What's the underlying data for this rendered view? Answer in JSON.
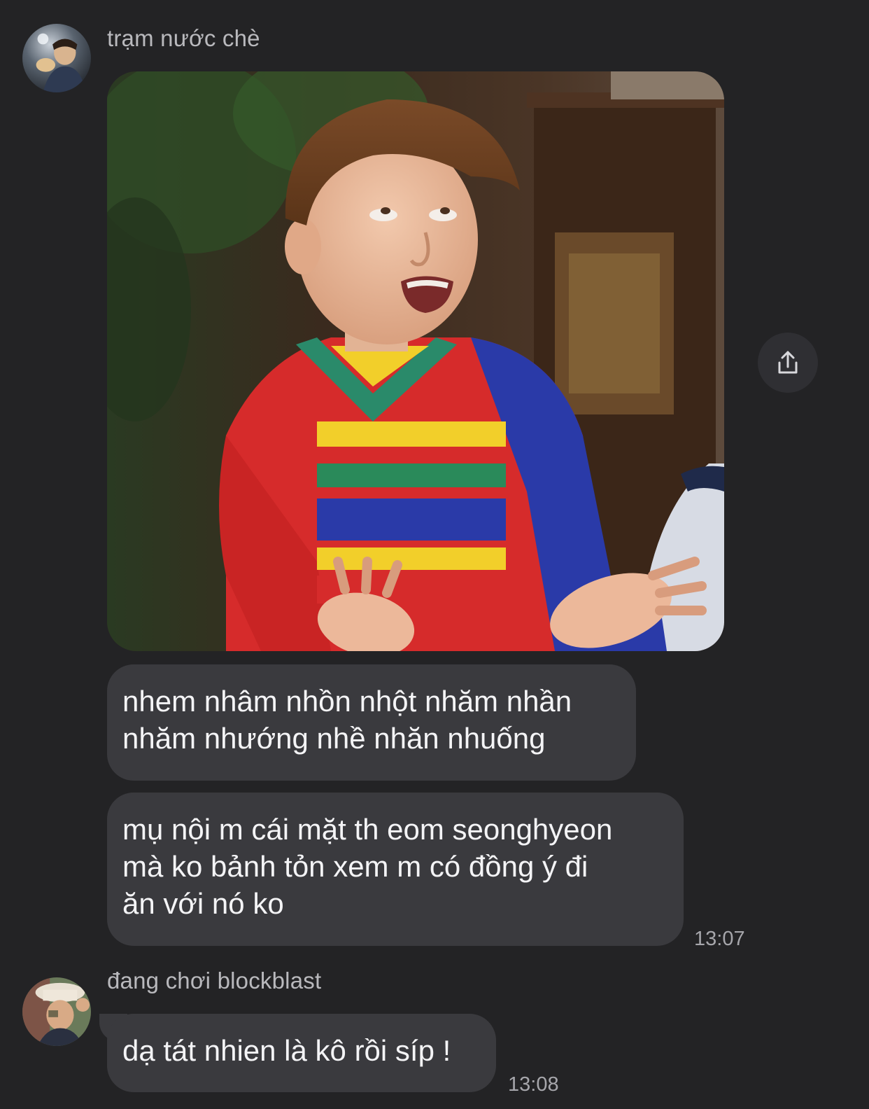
{
  "conversation": {
    "groups": [
      {
        "sender": "trạm nước chè",
        "messages": [
          "nhem nhâm nhồn nhột nhăm nhần\nnhăm nhướng nhề nhăn nhuống",
          "mụ nội m cái mặt th eom seonghyeon\nmà ko bảnh tỏn xem m có đồng ý đi\năn với nó ko"
        ],
        "time": "13:07"
      },
      {
        "sender": "đang chơi blockblast",
        "messages": [
          "dạ tát nhien là kô rồi síp !"
        ],
        "time": "13:08"
      }
    ]
  },
  "icons": {
    "share": "share-icon"
  },
  "colors": {
    "background": "#232325",
    "bubble": "#3a3a3e",
    "name_text": "#b9b9bd",
    "time_text": "#a6a6ab"
  }
}
